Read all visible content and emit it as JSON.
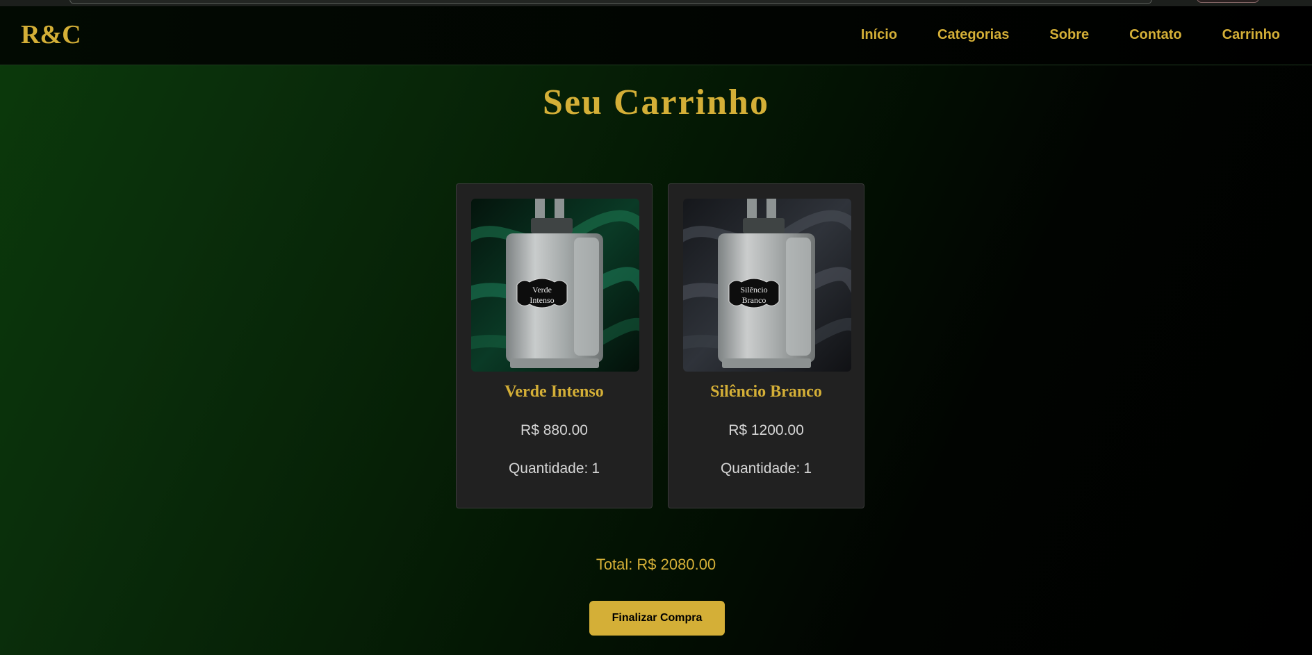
{
  "brand": {
    "logo": "R&C"
  },
  "nav": {
    "items": [
      "Início",
      "Categorias",
      "Sobre",
      "Contato",
      "Carrinho"
    ]
  },
  "page": {
    "title": "Seu Carrinho"
  },
  "cart": {
    "quantity_label": "Quantidade:",
    "items": [
      {
        "name": "Verde Intenso",
        "price": "R$ 880.00",
        "quantity": "1",
        "label_line1": "Verde",
        "label_line2": "Intenso",
        "backdrop": "green-silk"
      },
      {
        "name": "Silêncio Branco",
        "price": "R$ 1200.00",
        "quantity": "1",
        "label_line1": "Silêncio",
        "label_line2": "Branco",
        "backdrop": "gray-silk"
      }
    ]
  },
  "summary": {
    "total_label": "Total:",
    "total_value": "R$ 2080.00"
  },
  "actions": {
    "checkout_label": "Finalizar Compra"
  },
  "colors": {
    "accent": "#d4af37",
    "card_bg": "#212121",
    "bg_green": "#0b3a0b",
    "bg_black": "#000000"
  }
}
